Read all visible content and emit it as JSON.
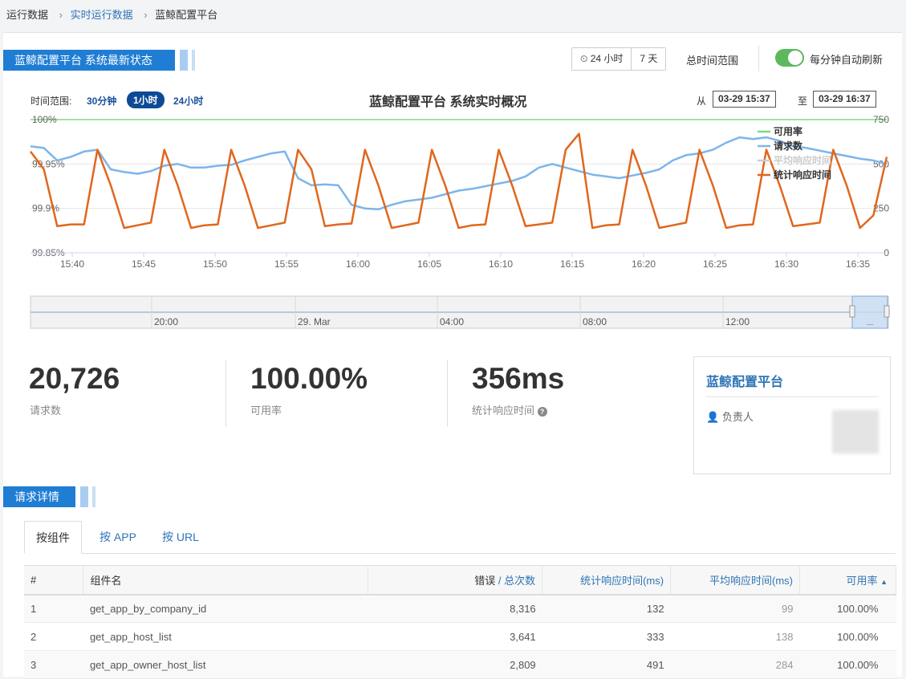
{
  "breadcrumb": {
    "item1": "运行数据",
    "item2": "实时运行数据",
    "item3": "蓝鲸配置平台"
  },
  "header": {
    "section_title": "蓝鲸配置平台 系统最新状态",
    "range_24h": "24 小时",
    "range_7d": "7 天",
    "total_range": "总时间范围",
    "auto_refresh": "每分钟自动刷新"
  },
  "chart_controls": {
    "range_label": "时间范围:",
    "opt_30m": "30分钟",
    "opt_1h": "1小时",
    "opt_24h": "24小时",
    "from_label": "从",
    "from_value": "03-29 15:37",
    "to_label": "至",
    "to_value": "03-29 16:37"
  },
  "chart_data": {
    "type": "line",
    "title": "蓝鲸配置平台 系统实时概况",
    "x_ticks": [
      "15:40",
      "15:45",
      "15:50",
      "15:55",
      "16:00",
      "16:05",
      "16:10",
      "16:15",
      "16:20",
      "16:25",
      "16:30",
      "16:35"
    ],
    "y_left_ticks": [
      "100%",
      "99.95%",
      "99.9%",
      "99.85%"
    ],
    "y_left_range": [
      99.85,
      100
    ],
    "y_right_ticks": [
      "750",
      "500",
      "250",
      "0"
    ],
    "y_right_range": [
      0,
      750
    ],
    "grid": true,
    "legend_position": "top-right",
    "legend": [
      "可用率",
      "请求数",
      "平均响应时间",
      "统计响应时间"
    ],
    "series": [
      {
        "name": "可用率",
        "color": "#7ddb7d",
        "axis": "left",
        "values": "constant 100%"
      },
      {
        "name": "请求数",
        "color": "#7cb5ec",
        "axis": "right",
        "values": [
          600,
          590,
          520,
          540,
          570,
          580,
          470,
          455,
          445,
          460,
          490,
          500,
          480,
          480,
          490,
          495,
          520,
          540,
          560,
          570,
          420,
          380,
          385,
          380,
          270,
          250,
          245,
          270,
          290,
          300,
          310,
          330,
          350,
          360,
          375,
          390,
          405,
          430,
          480,
          500,
          480,
          460,
          440,
          430,
          420,
          435,
          450,
          470,
          520,
          550,
          560,
          580,
          620,
          650,
          640,
          650,
          630,
          600,
          590,
          575,
          560,
          545,
          530,
          520,
          500
        ]
      },
      {
        "name": "平均响应时间",
        "color": "#cccccc",
        "axis": "right",
        "values": []
      },
      {
        "name": "统计响应时间",
        "color": "#e0671d",
        "axis": "right",
        "values": [
          570,
          470,
          150,
          160,
          160,
          580,
          380,
          140,
          155,
          170,
          580,
          380,
          140,
          155,
          160,
          580,
          380,
          140,
          155,
          170,
          580,
          470,
          150,
          160,
          165,
          580,
          380,
          140,
          155,
          170,
          580,
          380,
          140,
          155,
          160,
          580,
          380,
          150,
          160,
          170,
          580,
          670,
          140,
          155,
          160,
          580,
          380,
          140,
          155,
          170,
          580,
          380,
          140,
          155,
          160,
          580,
          380,
          150,
          160,
          170,
          580,
          380,
          140,
          210,
          540
        ]
      }
    ]
  },
  "navigator": {
    "ticks": [
      "20:00",
      "29. Mar",
      "04:00",
      "08:00",
      "12:00"
    ],
    "handle_label": "..."
  },
  "stats": {
    "requests_value": "20,726",
    "requests_label": "请求数",
    "availability_value": "100.00%",
    "availability_label": "可用率",
    "response_value": "356ms",
    "response_label": "统计响应时间"
  },
  "owner_card": {
    "title": "蓝鲸配置平台",
    "owner_label": "负责人"
  },
  "details": {
    "section_title": "请求详情",
    "tabs": [
      "按组件",
      "按 APP",
      "按 URL"
    ],
    "columns": {
      "index": "#",
      "name": "组件名",
      "errors": "错误",
      "total": "总次数",
      "stat_rt": "统计响应时间(ms)",
      "avg_rt": "平均响应时间(ms)",
      "availability": "可用率"
    },
    "rows": [
      {
        "index": "1",
        "name": "get_app_by_company_id",
        "total": "8,316",
        "stat_rt": "132",
        "avg_rt": "99",
        "availability": "100.00%"
      },
      {
        "index": "2",
        "name": "get_app_host_list",
        "total": "3,641",
        "stat_rt": "333",
        "avg_rt": "138",
        "availability": "100.00%"
      },
      {
        "index": "3",
        "name": "get_app_owner_host_list",
        "total": "2,809",
        "stat_rt": "491",
        "avg_rt": "284",
        "availability": "100.00%"
      }
    ]
  }
}
